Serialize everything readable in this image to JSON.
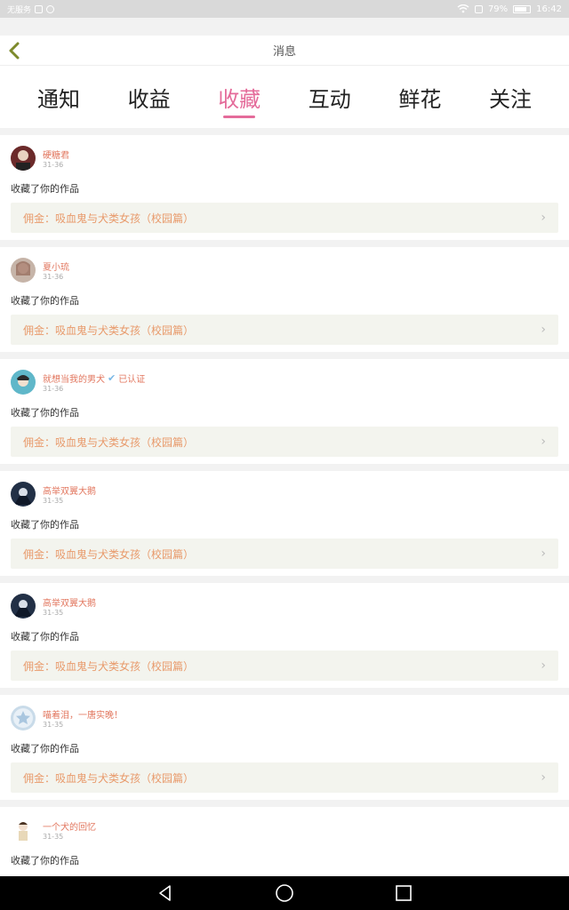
{
  "status": {
    "carrier": "无服务",
    "battery": "79%",
    "time": "16:42"
  },
  "header": {
    "title": "消息"
  },
  "tabs": [
    {
      "label": "通知"
    },
    {
      "label": "收益"
    },
    {
      "label": "收藏"
    },
    {
      "label": "互动"
    },
    {
      "label": "鲜花"
    },
    {
      "label": "关注"
    }
  ],
  "items": [
    {
      "user": "硬糖君",
      "date": "31-36",
      "action": "收藏了你的作品",
      "work": "佣金：吸血鬼与犬类女孩（校园篇）",
      "avatar_color": "#6b2a2a"
    },
    {
      "user": "夏小琉",
      "date": "31-36",
      "action": "收藏了你的作品",
      "work": "佣金：吸血鬼与犬类女孩（校园篇）",
      "avatar_color": "#c6b4a8"
    },
    {
      "user": "就想当我的男犬",
      "verified": "已认证",
      "date": "31-36",
      "action": "收藏了你的作品",
      "work": "佣金：吸血鬼与犬类女孩（校园篇）",
      "avatar_color": "#5fb7c9"
    },
    {
      "user": "高举双翼大鹅",
      "date": "31-35",
      "action": "收藏了你的作品",
      "work": "佣金：吸血鬼与犬类女孩（校园篇）",
      "avatar_color": "#223046"
    },
    {
      "user": "高举双翼大鹅",
      "date": "31-35",
      "action": "收藏了你的作品",
      "work": "佣金：吸血鬼与犬类女孩（校园篇）",
      "avatar_color": "#223046"
    },
    {
      "user": "喵着泪，一唐实晚！",
      "date": "31-35",
      "action": "收藏了你的作品",
      "work": "佣金：吸血鬼与犬类女孩（校园篇）",
      "avatar_color": "#c9dbe9"
    },
    {
      "user": "一个犬的回忆",
      "date": "31-35",
      "action": "收藏了你的作品",
      "work": "",
      "avatar_color": "#e8d8b8"
    }
  ]
}
